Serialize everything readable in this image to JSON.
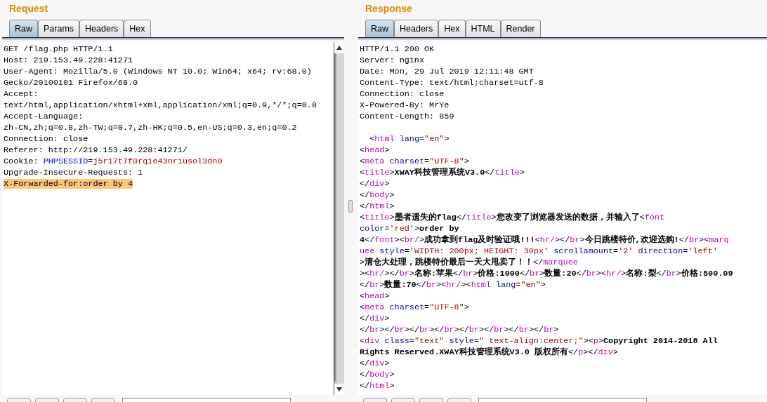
{
  "request": {
    "title": "Request",
    "tabs": [
      {
        "label": "Raw",
        "selected": true
      },
      {
        "label": "Params",
        "selected": false
      },
      {
        "label": "Headers",
        "selected": false
      },
      {
        "label": "Hex",
        "selected": false
      }
    ],
    "lines": [
      {
        "segments": [
          {
            "kind": "plain",
            "text": "GET /flag.php HTTP/1.1"
          }
        ]
      },
      {
        "segments": [
          {
            "kind": "plain",
            "text": "Host: 219.153.49.228:41271"
          }
        ]
      },
      {
        "segments": [
          {
            "kind": "plain",
            "text": "User-Agent: Mozilla/5.0 (Windows NT 10.0; Win64; x64; rv:68.0)"
          }
        ]
      },
      {
        "segments": [
          {
            "kind": "plain",
            "text": "Gecko/20100101 Firefox/68.0"
          }
        ]
      },
      {
        "segments": [
          {
            "kind": "plain",
            "text": "Accept:"
          }
        ]
      },
      {
        "segments": [
          {
            "kind": "plain",
            "text": "text/html,application/xhtml+xml,application/xml;q=0.9,*/*;q=0.8"
          }
        ]
      },
      {
        "segments": [
          {
            "kind": "plain",
            "text": "Accept-Language:"
          }
        ]
      },
      {
        "segments": [
          {
            "kind": "plain",
            "text": "zh-CN,zh;q=0.8,zh-TW;q=0.7,zh-HK;q=0.5,en-US;q=0.3,en;q=0.2"
          }
        ]
      },
      {
        "segments": [
          {
            "kind": "plain",
            "text": "Connection: close"
          }
        ]
      },
      {
        "segments": [
          {
            "kind": "plain",
            "text": "Referer: http://219.153.49.228:41271/"
          }
        ]
      },
      {
        "segments": [
          {
            "kind": "plain",
            "text": "Cookie: "
          },
          {
            "kind": "key",
            "text": "PHPSESSID"
          },
          {
            "kind": "plain",
            "text": "="
          },
          {
            "kind": "value",
            "text": "j5r17t7f0rq1e43nr1usol3dn0"
          }
        ]
      },
      {
        "segments": [
          {
            "kind": "plain",
            "text": "Upgrade-Insecure-Requests: 1"
          }
        ]
      },
      {
        "segments": [
          {
            "kind": "highlight",
            "text": "X-Forwarded-for:order by 4"
          }
        ]
      }
    ]
  },
  "response": {
    "title": "Response",
    "tabs": [
      {
        "label": "Raw",
        "selected": true
      },
      {
        "label": "Headers",
        "selected": false
      },
      {
        "label": "Hex",
        "selected": false
      },
      {
        "label": "HTML",
        "selected": false
      },
      {
        "label": "Render",
        "selected": false
      }
    ],
    "lines": [
      {
        "segments": [
          {
            "kind": "plain",
            "text": "HTTP/1.1 200 OK"
          }
        ]
      },
      {
        "segments": [
          {
            "kind": "plain",
            "text": "Server: nginx"
          }
        ]
      },
      {
        "segments": [
          {
            "kind": "plain",
            "text": "Date: Mon, 29 Jul 2019 12:11:48 GMT"
          }
        ]
      },
      {
        "segments": [
          {
            "kind": "plain",
            "text": "Content-Type: text/html;charset=utf-8"
          }
        ]
      },
      {
        "segments": [
          {
            "kind": "plain",
            "text": "Connection: close"
          }
        ]
      },
      {
        "segments": [
          {
            "kind": "plain",
            "text": "X-Powered-By: MrYe"
          }
        ]
      },
      {
        "segments": [
          {
            "kind": "plain",
            "text": "Content-Length: 859"
          }
        ]
      },
      {
        "blank": true
      },
      {
        "segments": [
          {
            "kind": "plain",
            "text": "  <"
          },
          {
            "kind": "tag",
            "text": "html"
          },
          {
            "kind": "attr",
            "text": " lang"
          },
          {
            "kind": "plain",
            "text": "="
          },
          {
            "kind": "value",
            "text": "\"en\""
          },
          {
            "kind": "plain",
            "text": ">"
          }
        ]
      },
      {
        "segments": [
          {
            "kind": "plain",
            "text": "<"
          },
          {
            "kind": "tag",
            "text": "head"
          },
          {
            "kind": "plain",
            "text": ">"
          }
        ]
      },
      {
        "segments": [
          {
            "kind": "plain",
            "text": "<"
          },
          {
            "kind": "tag",
            "text": "meta"
          },
          {
            "kind": "attr",
            "text": " charset"
          },
          {
            "kind": "plain",
            "text": "="
          },
          {
            "kind": "value",
            "text": "\"UTF-8\""
          },
          {
            "kind": "plain",
            "text": ">"
          }
        ]
      },
      {
        "segments": [
          {
            "kind": "plain",
            "text": "<"
          },
          {
            "kind": "tag",
            "text": "title"
          },
          {
            "kind": "plain",
            "text": ">"
          },
          {
            "kind": "content",
            "text": "XWAY科技管理系统V3.0"
          },
          {
            "kind": "plain",
            "text": "</"
          },
          {
            "kind": "tag",
            "text": "title"
          },
          {
            "kind": "plain",
            "text": ">"
          }
        ]
      },
      {
        "segments": [
          {
            "kind": "plain",
            "text": "</"
          },
          {
            "kind": "tag",
            "text": "div"
          },
          {
            "kind": "plain",
            "text": ">"
          }
        ]
      },
      {
        "segments": [
          {
            "kind": "plain",
            "text": "</"
          },
          {
            "kind": "tag",
            "text": "body"
          },
          {
            "kind": "plain",
            "text": ">"
          }
        ]
      },
      {
        "segments": [
          {
            "kind": "plain",
            "text": "</"
          },
          {
            "kind": "tag",
            "text": "html"
          },
          {
            "kind": "plain",
            "text": ">"
          }
        ]
      },
      {
        "segments": [
          {
            "kind": "plain",
            "text": "<"
          },
          {
            "kind": "tag",
            "text": "title"
          },
          {
            "kind": "plain",
            "text": ">"
          },
          {
            "kind": "content",
            "text": "墨者遗失的flag"
          },
          {
            "kind": "plain",
            "text": "</"
          },
          {
            "kind": "tag",
            "text": "title"
          },
          {
            "kind": "plain",
            "text": ">"
          },
          {
            "kind": "content",
            "text": "您改变了浏览器发送的数据，并输入了"
          },
          {
            "kind": "plain",
            "text": "<"
          },
          {
            "kind": "tag",
            "text": "font"
          }
        ]
      },
      {
        "segments": [
          {
            "kind": "attr",
            "text": "color"
          },
          {
            "kind": "plain",
            "text": "="
          },
          {
            "kind": "value",
            "text": "'red'"
          },
          {
            "kind": "plain",
            "text": ">"
          },
          {
            "kind": "content",
            "text": "order by"
          }
        ]
      },
      {
        "segments": [
          {
            "kind": "content",
            "text": "4"
          },
          {
            "kind": "plain",
            "text": "</"
          },
          {
            "kind": "tag",
            "text": "font"
          },
          {
            "kind": "plain",
            "text": "><"
          },
          {
            "kind": "tag",
            "text": "br/"
          },
          {
            "kind": "plain",
            "text": ">"
          },
          {
            "kind": "content",
            "text": "成功拿到flag及时验证哦!!!"
          },
          {
            "kind": "plain",
            "text": "<"
          },
          {
            "kind": "tag",
            "text": "hr/"
          },
          {
            "kind": "plain",
            "text": "></"
          },
          {
            "kind": "tag",
            "text": "br"
          },
          {
            "kind": "plain",
            "text": ">"
          },
          {
            "kind": "content",
            "text": "今日跳楼特价,欢迎选购!"
          },
          {
            "kind": "plain",
            "text": "</"
          },
          {
            "kind": "tag",
            "text": "br"
          },
          {
            "kind": "plain",
            "text": "><"
          },
          {
            "kind": "tag",
            "text": "marq"
          }
        ]
      },
      {
        "segments": [
          {
            "kind": "tag",
            "text": "uee"
          },
          {
            "kind": "attr",
            "text": " style"
          },
          {
            "kind": "plain",
            "text": "="
          },
          {
            "kind": "value",
            "text": "'WIDTH: 200px; HEIGHT: 30px'"
          },
          {
            "kind": "attr",
            "text": " scrollamount"
          },
          {
            "kind": "plain",
            "text": "="
          },
          {
            "kind": "value",
            "text": "'2'"
          },
          {
            "kind": "attr",
            "text": " direction"
          },
          {
            "kind": "plain",
            "text": "="
          },
          {
            "kind": "value",
            "text": "'left'"
          }
        ]
      },
      {
        "segments": [
          {
            "kind": "plain",
            "text": ">"
          },
          {
            "kind": "content",
            "text": "清仓大处理，跳楼特价最后一天大甩卖了！！"
          },
          {
            "kind": "plain",
            "text": "</"
          },
          {
            "kind": "tag",
            "text": "marquee"
          }
        ]
      },
      {
        "segments": [
          {
            "kind": "plain",
            "text": "><"
          },
          {
            "kind": "tag",
            "text": "hr/"
          },
          {
            "kind": "plain",
            "text": "></"
          },
          {
            "kind": "tag",
            "text": "br"
          },
          {
            "kind": "plain",
            "text": ">"
          },
          {
            "kind": "content",
            "text": "名称:苹果"
          },
          {
            "kind": "plain",
            "text": "</"
          },
          {
            "kind": "tag",
            "text": "br"
          },
          {
            "kind": "plain",
            "text": ">"
          },
          {
            "kind": "content",
            "text": "价格:1000"
          },
          {
            "kind": "plain",
            "text": "</"
          },
          {
            "kind": "tag",
            "text": "br"
          },
          {
            "kind": "plain",
            "text": ">"
          },
          {
            "kind": "content",
            "text": "数量:20"
          },
          {
            "kind": "plain",
            "text": "</"
          },
          {
            "kind": "tag",
            "text": "br"
          },
          {
            "kind": "plain",
            "text": "><"
          },
          {
            "kind": "tag",
            "text": "hr/"
          },
          {
            "kind": "plain",
            "text": ">"
          },
          {
            "kind": "content",
            "text": "名称:梨"
          },
          {
            "kind": "plain",
            "text": "</"
          },
          {
            "kind": "tag",
            "text": "br"
          },
          {
            "kind": "plain",
            "text": ">"
          },
          {
            "kind": "content",
            "text": "价格:500.09"
          }
        ]
      },
      {
        "segments": [
          {
            "kind": "plain",
            "text": "</"
          },
          {
            "kind": "tag",
            "text": "br"
          },
          {
            "kind": "plain",
            "text": ">"
          },
          {
            "kind": "content",
            "text": "数量:70"
          },
          {
            "kind": "plain",
            "text": "</"
          },
          {
            "kind": "tag",
            "text": "br"
          },
          {
            "kind": "plain",
            "text": "><"
          },
          {
            "kind": "tag",
            "text": "hr/"
          },
          {
            "kind": "plain",
            "text": "><"
          },
          {
            "kind": "tag",
            "text": "html"
          },
          {
            "kind": "attr",
            "text": " lang"
          },
          {
            "kind": "plain",
            "text": "="
          },
          {
            "kind": "value",
            "text": "\"en\""
          },
          {
            "kind": "plain",
            "text": ">"
          }
        ]
      },
      {
        "segments": [
          {
            "kind": "plain",
            "text": "<"
          },
          {
            "kind": "tag",
            "text": "head"
          },
          {
            "kind": "plain",
            "text": ">"
          }
        ]
      },
      {
        "segments": [
          {
            "kind": "plain",
            "text": "<"
          },
          {
            "kind": "tag",
            "text": "meta"
          },
          {
            "kind": "attr",
            "text": " charset"
          },
          {
            "kind": "plain",
            "text": "="
          },
          {
            "kind": "value",
            "text": "\"UTF-8\""
          },
          {
            "kind": "plain",
            "text": ">"
          }
        ]
      },
      {
        "segments": [
          {
            "kind": "plain",
            "text": "</"
          },
          {
            "kind": "tag",
            "text": "div"
          },
          {
            "kind": "plain",
            "text": ">"
          }
        ]
      },
      {
        "segments": [
          {
            "kind": "plain",
            "text": "</"
          },
          {
            "kind": "tag",
            "text": "br"
          },
          {
            "kind": "plain",
            "text": "></"
          },
          {
            "kind": "tag",
            "text": "br"
          },
          {
            "kind": "plain",
            "text": "></"
          },
          {
            "kind": "tag",
            "text": "br"
          },
          {
            "kind": "plain",
            "text": "></"
          },
          {
            "kind": "tag",
            "text": "br"
          },
          {
            "kind": "plain",
            "text": "></"
          },
          {
            "kind": "tag",
            "text": "br"
          },
          {
            "kind": "plain",
            "text": "></"
          },
          {
            "kind": "tag",
            "text": "br"
          },
          {
            "kind": "plain",
            "text": "></"
          },
          {
            "kind": "tag",
            "text": "br"
          },
          {
            "kind": "plain",
            "text": "></"
          },
          {
            "kind": "tag",
            "text": "br"
          },
          {
            "kind": "plain",
            "text": ">"
          }
        ]
      },
      {
        "segments": [
          {
            "kind": "plain",
            "text": "<"
          },
          {
            "kind": "tag",
            "text": "div"
          },
          {
            "kind": "attr",
            "text": " class"
          },
          {
            "kind": "plain",
            "text": "="
          },
          {
            "kind": "value",
            "text": "\"text\""
          },
          {
            "kind": "attr",
            "text": " style"
          },
          {
            "kind": "plain",
            "text": "="
          },
          {
            "kind": "value",
            "text": "\" text-align:center;\""
          },
          {
            "kind": "plain",
            "text": "><"
          },
          {
            "kind": "tag",
            "text": "p"
          },
          {
            "kind": "plain",
            "text": ">"
          },
          {
            "kind": "content",
            "text": "Copyright 2014-2018 All"
          }
        ]
      },
      {
        "segments": [
          {
            "kind": "content",
            "text": "Rights Reserved.XWAY科技管理系统V3.0 版权所有"
          },
          {
            "kind": "plain",
            "text": "</"
          },
          {
            "kind": "tag",
            "text": "p"
          },
          {
            "kind": "plain",
            "text": "></"
          },
          {
            "kind": "tag",
            "text": "div"
          },
          {
            "kind": "plain",
            "text": ">"
          }
        ]
      },
      {
        "segments": [
          {
            "kind": "plain",
            "text": "</"
          },
          {
            "kind": "tag",
            "text": "div"
          },
          {
            "kind": "plain",
            "text": ">"
          }
        ]
      },
      {
        "segments": [
          {
            "kind": "plain",
            "text": "</"
          },
          {
            "kind": "tag",
            "text": "body"
          },
          {
            "kind": "plain",
            "text": ">"
          }
        ]
      },
      {
        "segments": [
          {
            "kind": "plain",
            "text": "</"
          },
          {
            "kind": "tag",
            "text": "html"
          },
          {
            "kind": "plain",
            "text": ">"
          }
        ]
      }
    ]
  }
}
